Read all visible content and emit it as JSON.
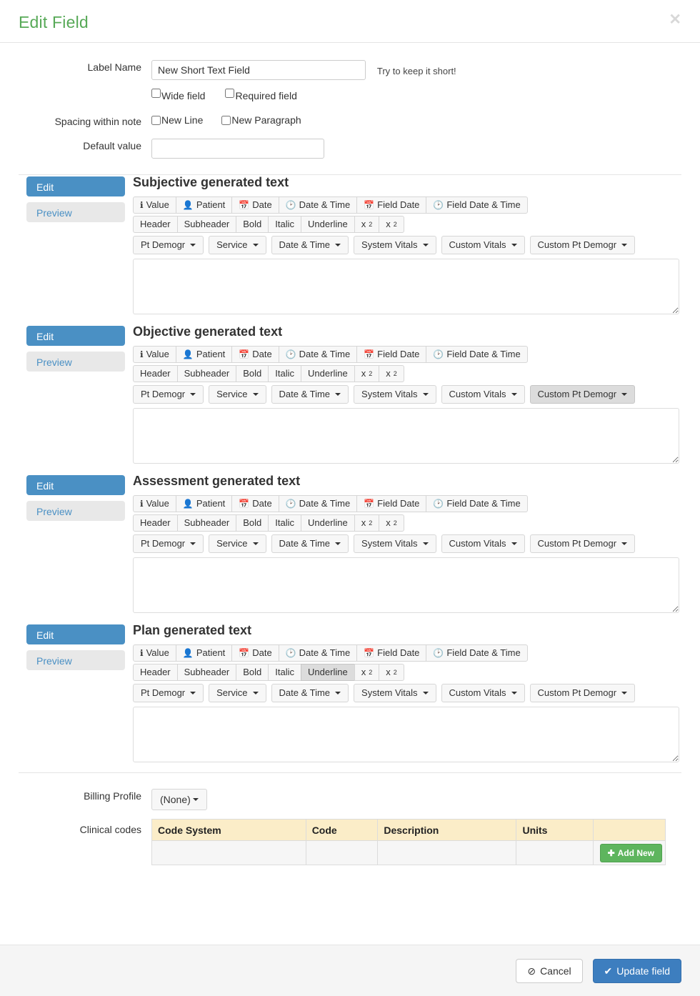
{
  "modal": {
    "title": "Edit Field",
    "close_icon": "close-icon",
    "close_glyph": "✕"
  },
  "form": {
    "label_name": {
      "label": "Label Name",
      "value": "New Short Text Field",
      "placeholder": "",
      "hint": "Try to keep it short!"
    },
    "checkboxes_field": [
      {
        "label": "Wide field",
        "checked": false
      },
      {
        "label": "Required field",
        "checked": false
      }
    ],
    "spacing": {
      "label": "Spacing within note",
      "options": [
        {
          "label": "New Line",
          "checked": false
        },
        {
          "label": "New Paragraph",
          "checked": false
        }
      ]
    },
    "default_value": {
      "label": "Default value",
      "value": "",
      "placeholder": ""
    }
  },
  "tabs": {
    "edit_label": "Edit",
    "preview_label": "Preview",
    "active_color": "#4a90c4",
    "inactive_bg": "#e8e8e8"
  },
  "toolbar": {
    "row1": [
      {
        "label": "Value",
        "icon": "info-circle-icon",
        "glyph": "ℹ"
      },
      {
        "label": "Patient",
        "icon": "person-icon",
        "glyph": "👤"
      },
      {
        "label": "Date",
        "icon": "calendar-icon",
        "glyph": "📅"
      },
      {
        "label": "Date & Time",
        "icon": "clock-icon",
        "glyph": "🕑"
      },
      {
        "label": "Field Date",
        "icon": "calendar-icon",
        "glyph": "📅"
      },
      {
        "label": "Field Date & Time",
        "icon": "clock-icon",
        "glyph": "🕑"
      }
    ],
    "row2": [
      {
        "label": "Header"
      },
      {
        "label": "Subheader"
      },
      {
        "label": "Bold"
      },
      {
        "label": "Italic"
      },
      {
        "label": "Underline"
      },
      {
        "label": "x",
        "sub": "2"
      },
      {
        "label": "x",
        "sup": "2"
      }
    ],
    "row3": [
      {
        "label": "Pt Demogr"
      },
      {
        "label": "Service"
      },
      {
        "label": "Date & Time"
      },
      {
        "label": "System Vitals"
      },
      {
        "label": "Custom Vitals"
      },
      {
        "label": "Custom Pt Demogr"
      }
    ]
  },
  "sections": [
    {
      "key": "subjective",
      "title": "Subjective generated text",
      "textarea_value": "",
      "pressed_row2": -1,
      "pressed_row3": -1
    },
    {
      "key": "objective",
      "title": "Objective generated text",
      "textarea_value": "",
      "pressed_row2": -1,
      "pressed_row3": 5
    },
    {
      "key": "assessment",
      "title": "Assessment generated text",
      "textarea_value": "",
      "pressed_row2": -1,
      "pressed_row3": -1
    },
    {
      "key": "plan",
      "title": "Plan generated text",
      "textarea_value": "",
      "pressed_row2": 4,
      "pressed_row3": -1
    }
  ],
  "billing": {
    "label": "Billing Profile",
    "selected": "(None)"
  },
  "clinical_codes": {
    "label": "Clinical codes",
    "columns": [
      "Code System",
      "Code",
      "Description",
      "Units",
      ""
    ],
    "rows": [],
    "add_new_label": "Add New",
    "add_new_icon": "plus-icon",
    "add_new_glyph": "✚",
    "add_new_color": "#5eb55e"
  },
  "footer": {
    "cancel_label": "Cancel",
    "cancel_icon": "ban-icon",
    "cancel_glyph": "⊘",
    "submit_label": "Update field",
    "submit_icon": "check-icon",
    "submit_glyph": "✔",
    "submit_color": "#3d7ebf"
  }
}
